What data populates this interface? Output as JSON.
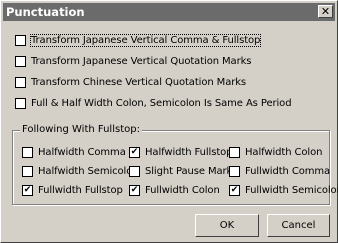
{
  "window": {
    "title": "Punctuation",
    "close_glyph": "✕"
  },
  "options": [
    {
      "label": "Transform Japanese Vertical Comma & Fullstop",
      "checked": false
    },
    {
      "label": "Transform Japanese Vertical Quotation Marks",
      "checked": false
    },
    {
      "label": "Transform Chinese Vertical Quotation Marks",
      "checked": false
    },
    {
      "label": "Full & Half Width Colon, Semicolon Is Same As Period",
      "checked": false
    }
  ],
  "group": {
    "title": "Following With Fullstop:",
    "items": [
      {
        "label": "Halfwidth Comma",
        "checked": false
      },
      {
        "label": "Halfwidth Fullstop",
        "checked": true
      },
      {
        "label": "Halfwidth Colon",
        "checked": false
      },
      {
        "label": "Halfwidth Semicolon",
        "checked": false
      },
      {
        "label": "Slight Pause Mark",
        "checked": false
      },
      {
        "label": "Fullwidth Comma",
        "checked": false
      },
      {
        "label": "Fullwidth Fullstop",
        "checked": true
      },
      {
        "label": "Fullwidth Colon",
        "checked": true
      },
      {
        "label": "Fullwidth Semicolon",
        "checked": true
      }
    ]
  },
  "buttons": {
    "ok": "OK",
    "cancel": "Cancel"
  }
}
